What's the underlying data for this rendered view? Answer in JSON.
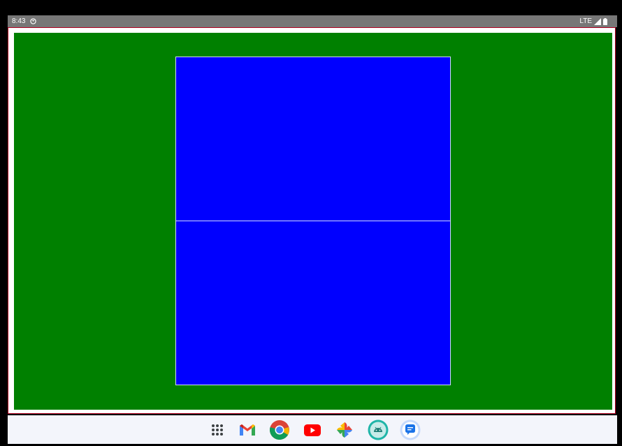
{
  "status_bar": {
    "time": "8:43",
    "network": "LTE",
    "icons": [
      "sync-icon",
      "signal-icon",
      "battery-icon"
    ]
  },
  "app": {
    "background_color": "#008000",
    "panel_color": "#0000ff",
    "frame_border_color": "#b00020"
  },
  "taskbar": {
    "apps": [
      {
        "name": "app-drawer",
        "icon": "grid-icon"
      },
      {
        "name": "gmail",
        "icon": "gmail-icon"
      },
      {
        "name": "chrome",
        "icon": "chrome-icon"
      },
      {
        "name": "youtube",
        "icon": "youtube-icon"
      },
      {
        "name": "photos",
        "icon": "photos-icon"
      },
      {
        "name": "android-app",
        "icon": "android-icon"
      },
      {
        "name": "messages",
        "icon": "messages-icon"
      }
    ]
  }
}
